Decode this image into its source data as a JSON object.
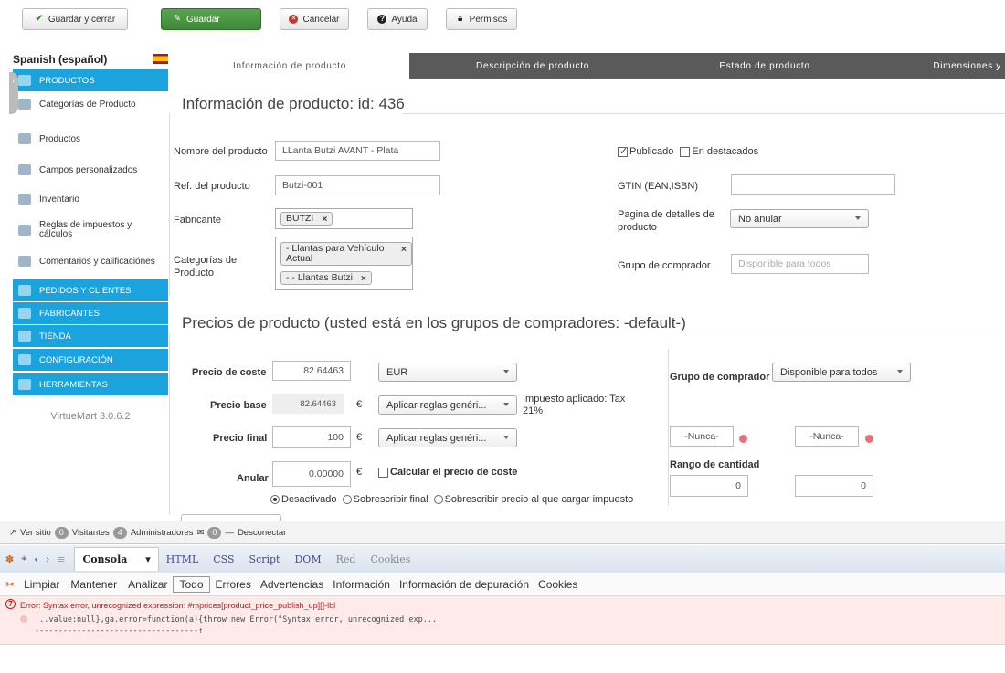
{
  "toolbar": {
    "save_close": "Guardar y cerrar",
    "save": "Guardar",
    "cancel": "Cancelar",
    "help": "Ayuda",
    "permissions": "Permisos"
  },
  "sidebar": {
    "language": "Spanish (español)",
    "items": [
      {
        "label": "PRODUCTOS",
        "type": "head",
        "icon": "products-icon"
      },
      {
        "label": "Categorías de Producto",
        "type": "link",
        "icon": "categories-icon"
      },
      {
        "label": "Productos",
        "type": "link",
        "icon": "product-icon"
      },
      {
        "label": "Campos personalizados",
        "type": "link",
        "icon": "custom-fields-icon"
      },
      {
        "label": "Inventario",
        "type": "link",
        "icon": "inventory-icon"
      },
      {
        "label": "Reglas de impuestos y cálculos",
        "type": "link",
        "icon": "tax-rules-icon"
      },
      {
        "label": "Comentarios y calificaciónes",
        "type": "link",
        "icon": "comments-icon"
      },
      {
        "label": "PEDIDOS Y CLIENTES",
        "type": "head",
        "icon": "orders-icon"
      },
      {
        "label": "FABRICANTES",
        "type": "head",
        "icon": "manufacturers-icon"
      },
      {
        "label": "TIENDA",
        "type": "head",
        "icon": "shop-icon"
      },
      {
        "label": "CONFIGURACIÓN",
        "type": "head",
        "icon": "config-icon"
      },
      {
        "label": "HERRAMIENTAS",
        "type": "head",
        "icon": "tools-icon"
      }
    ],
    "version": "VirtueMart 3.0.6.2"
  },
  "tabs": [
    "Información de producto",
    "Descripción de producto",
    "Estado de producto",
    "Dimensiones y"
  ],
  "info": {
    "title": "Información de producto: id: 436",
    "name_label": "Nombre del producto",
    "name_value": "LLanta Butzi AVANT - Plata",
    "sku_label": "Ref. del producto",
    "sku_value": "Butzi-001",
    "manufacturer_label": "Fabricante",
    "manufacturer_chip": "BUTZI",
    "categories_label": "Categorías de Producto",
    "category_chip_1": "- Llantas para Vehículo Actual",
    "category_chip_2": "- - Llantas Butzi",
    "published_label": "Publicado",
    "featured_label": "En destacados",
    "gtin_label": "GTIN (EAN,ISBN)",
    "gtin_value": "",
    "details_page_label": "Pagina de detalles de producto",
    "details_page_value": "No anular",
    "shopper_group_label": "Grupo de comprador",
    "shopper_group_placeholder": "Disponible para todos"
  },
  "prices": {
    "title": "Precios de producto (usted está en los grupos de compradores: -default-)",
    "cost_label": "Precio de coste",
    "cost_value": "82.64463",
    "currency": "EUR",
    "base_label": "Precio base",
    "base_value": "82.64463",
    "euro": "€",
    "rules_1": "Aplicar reglas genéri...",
    "tax_applied": "Impuesto aplicado: Tax 21%",
    "final_label": "Precio final",
    "final_value": "100",
    "rules_2": "Aplicar reglas genéri...",
    "override_label": "Anular",
    "override_value": "0.00000",
    "calc_cost_label": "Calcular el precio de coste",
    "radio_disabled": "Desactivado",
    "radio_override": "Sobrescribir final",
    "radio_override_tax": "Sobrescribir precio al que cargar impuesto",
    "shopper_group_label": "Grupo de comprador",
    "shopper_group_value": "Disponible para todos",
    "never_1": "-Nunca-",
    "never_2": "-Nunca-",
    "quantity_range_label": "Rango de cantidad",
    "qty_from": "0",
    "qty_to": "0"
  },
  "adminbar": {
    "site": "Ver sitio",
    "visitors_count": "0",
    "visitors": "Visitantes",
    "admins_count": "4",
    "admins": "Administradores",
    "messages_count": "0",
    "logout": "Desconectar"
  },
  "firebug": {
    "console": "Consola",
    "tabs": [
      "HTML",
      "CSS",
      "Script",
      "DOM",
      "Red",
      "Cookies"
    ],
    "filters": [
      "Limpiar",
      "Mantener",
      "Analizar",
      "Todo",
      "Errores",
      "Advertencias",
      "Información",
      "Información de depuración",
      "Cookies"
    ],
    "error_message": "Error: Syntax error, unrecognized expression: #mprices[product_price_publish_up][]-lbl",
    "error_code_1": "...value:null},ga.error=function(a){throw new Error(\"Syntax error, unrecognized exp...",
    "error_code_2": "-----------------------------------↑"
  },
  "colors": {
    "accent_blue": "#1aa3dc",
    "save_green": "#4a9a42",
    "tab_bar": "#5a5a5a",
    "error_red": "#c41a1a"
  }
}
